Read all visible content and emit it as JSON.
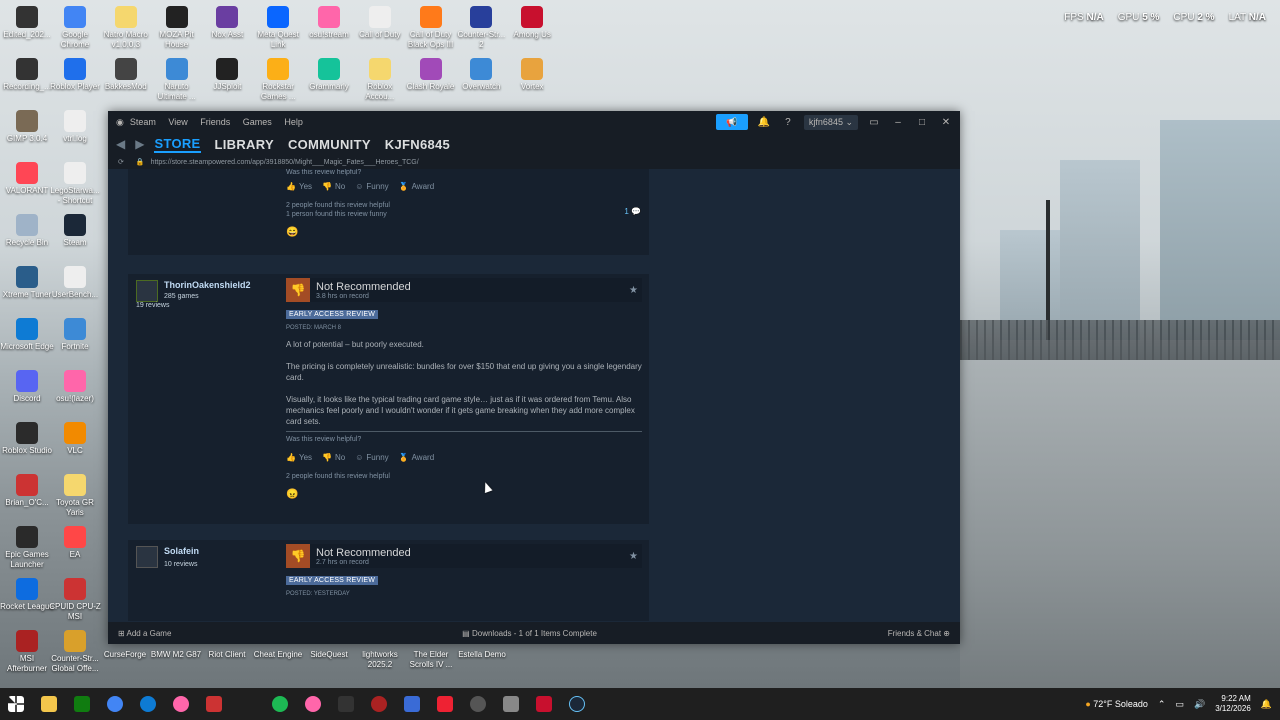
{
  "desktop": {
    "icons": [
      {
        "label": "Edited_202...",
        "color": "#333"
      },
      {
        "label": "Google Chrome",
        "color": "#4285f4"
      },
      {
        "label": "Natro Macro v1.0.0.3",
        "color": "#f5d76e"
      },
      {
        "label": "MOZA Pit House",
        "color": "#222"
      },
      {
        "label": "Nox Asst",
        "color": "#6a3ea1"
      },
      {
        "label": "Meta Quest Link",
        "color": "#0a66ff"
      },
      {
        "label": "osu!stream",
        "color": "#ff66aa"
      },
      {
        "label": "Call of Duty",
        "color": "#eee"
      },
      {
        "label": "Call of Duty Black Ops III",
        "color": "#ff7a1a"
      },
      {
        "label": "Counter-Str... 2",
        "color": "#283f9b"
      },
      {
        "label": "Among Us",
        "color": "#c8102e"
      },
      {
        "label": "Recording_...",
        "color": "#333"
      },
      {
        "label": "Roblox Player",
        "color": "#1f6feb"
      },
      {
        "label": "BakkesMod",
        "color": "#444"
      },
      {
        "label": "Naruto Ultimate ...",
        "color": "#3d8ad6"
      },
      {
        "label": "JJSploit",
        "color": "#222"
      },
      {
        "label": "Rockstar Games ...",
        "color": "#fcaf17"
      },
      {
        "label": "Grammarly",
        "color": "#15c39a"
      },
      {
        "label": "Roblox Accou...",
        "color": "#f5d76e"
      },
      {
        "label": "Clash Royale",
        "color": "#a14ab8"
      },
      {
        "label": "Overwatch",
        "color": "#3d8ad6"
      },
      {
        "label": "Vortex",
        "color": "#e8a33e"
      },
      {
        "label": "GIMP 3.0.4",
        "color": "#7a6a55"
      },
      {
        "label": "vtrl.log",
        "color": "#eee"
      },
      {
        "label": "VALORANT",
        "color": "#ff4655"
      },
      {
        "label": "LegoStarwa... - Shortcut",
        "color": "#eee"
      },
      {
        "label": "Recycle Bin",
        "color": "#9fb3c8"
      },
      {
        "label": "Steam",
        "color": "#1b2838"
      },
      {
        "label": "Xtreme Tuner",
        "color": "#2a5d8a"
      },
      {
        "label": "UserBench...",
        "color": "#eee"
      },
      {
        "label": "Microsoft Edge",
        "color": "#0e7bd4"
      },
      {
        "label": "Fortnite",
        "color": "#3d8ad6"
      },
      {
        "label": "Discord",
        "color": "#5865f2"
      },
      {
        "label": "osu!(lazer)",
        "color": "#ff66aa"
      },
      {
        "label": "Roblox Studio",
        "color": "#2b2b2b"
      },
      {
        "label": "VLC",
        "color": "#f28a00"
      },
      {
        "label": "Brian_O'C...",
        "color": "#c33"
      },
      {
        "label": "Toyota GR Yaris",
        "color": "#f5d76e"
      },
      {
        "label": "Epic Games Launcher",
        "color": "#2a2a2a"
      },
      {
        "label": "EA",
        "color": "#ff4747"
      },
      {
        "label": "Rocket League",
        "color": "#0d6ce0"
      },
      {
        "label": "CPUID CPU-Z MSI",
        "color": "#c33"
      },
      {
        "label": "MSI Afterburner",
        "color": "#a22"
      },
      {
        "label": "Counter-Str... Global Offe...",
        "color": "#d9a02b"
      }
    ],
    "bottom_row": [
      "CurseForge",
      "BMW M2 G87",
      "Riot Client",
      "Cheat Engine",
      "SideQuest",
      "lightworks 2025.2",
      "The Elder Scrolls IV ...",
      "Estella Demo"
    ]
  },
  "hud": {
    "fps_label": "FPS",
    "fps_val": "N/A",
    "gpu_label": "GPU",
    "gpu_val": "5 %",
    "cpu_label": "CPU",
    "cpu_val": "2 %",
    "lat_label": "LAT",
    "lat_val": "N/A"
  },
  "steam": {
    "menu": [
      "Steam",
      "View",
      "Friends",
      "Games",
      "Help"
    ],
    "account": "kjfn6845 ⌄",
    "tabs": [
      "STORE",
      "LIBRARY",
      "COMMUNITY",
      "KJFN6845"
    ],
    "url": "https://store.steampowered.com/app/3918850/Might___Magic_Fates___Heroes_TCG/",
    "review0": {
      "helpful_q": "Was this review helpful?",
      "yes": "Yes",
      "no": "No",
      "funny": "Funny",
      "award": "Award",
      "found1": "2 people found this review helpful",
      "found2": "1 person found this review funny",
      "comments": "1",
      "emoji": "😄"
    },
    "review1": {
      "username": "ThorinOakenshield2",
      "games": "285 games",
      "reviews": "19 reviews",
      "verdict": "Not Recommended",
      "hours": "3.8 hrs on record",
      "badge": "EARLY ACCESS REVIEW",
      "posted": "POSTED: MARCH 8",
      "p1": "A lot of potential – but poorly executed.",
      "p2": "The pricing is completely unrealistic: bundles for over $150 that end up giving you a single legendary card.",
      "p3": "Visually, it looks like the typical trading card game style… just as if it was ordered from Temu. Also mechanics feel poorly and I wouldn't wonder if it gets game breaking when they add more complex card sets.",
      "helpful_q": "Was this review helpful?",
      "yes": "Yes",
      "no": "No",
      "funny": "Funny",
      "award": "Award",
      "found": "2 people found this review helpful",
      "emoji": "😠"
    },
    "review2": {
      "username": "Solafein",
      "reviews": "10 reviews",
      "verdict": "Not Recommended",
      "hours": "2.7 hrs on record",
      "badge": "EARLY ACCESS REVIEW",
      "posted": "POSTED: YESTERDAY"
    },
    "status": {
      "add_game": "Add a Game",
      "downloads": "Downloads - 1 of 1 Items Complete",
      "friends": "Friends & Chat"
    }
  },
  "tray": {
    "weather": "72°F  Soleado",
    "time": "9:22 AM",
    "date": "3/12/2026"
  }
}
